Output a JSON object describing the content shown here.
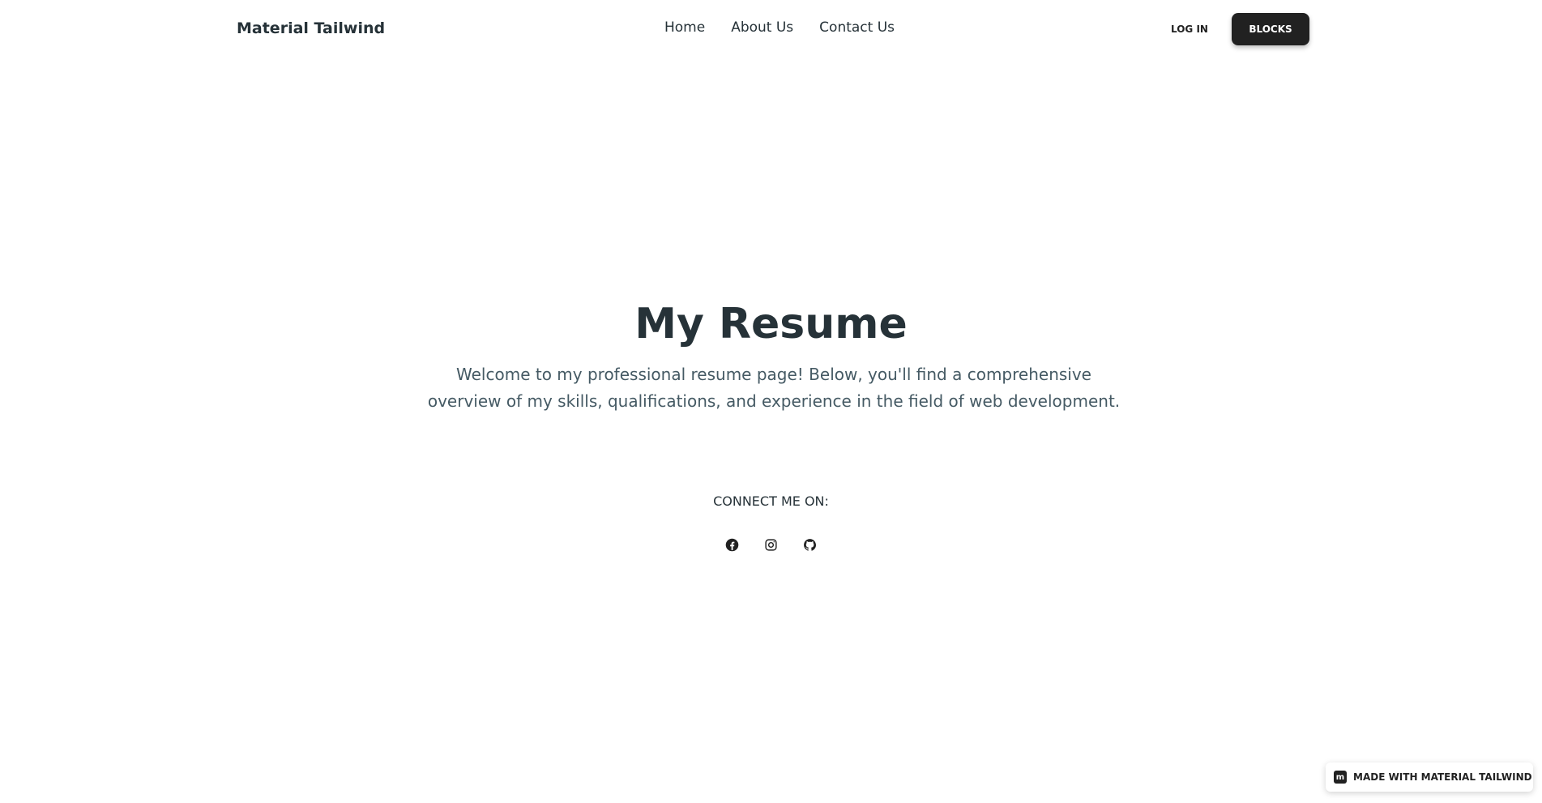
{
  "navbar": {
    "brand": "Material Tailwind",
    "links": [
      "Home",
      "About Us",
      "Contact Us"
    ],
    "login_label": "LOG IN",
    "blocks_label": "BLOCKS"
  },
  "hero": {
    "title": "My Resume",
    "description": "Welcome to my professional resume page! Below, you'll find a comprehensive overview of my skills, qualifications, and experience in the field of web development.",
    "connect_label": "CONNECT ME ON:",
    "social_icons": [
      "facebook-icon",
      "instagram-icon",
      "github-icon"
    ]
  },
  "badge": {
    "logo_letter": "m",
    "label": "MADE WITH MATERIAL TAILWIND"
  },
  "colors": {
    "text_primary": "#263238",
    "text_secondary": "#455a64",
    "button_dark": "#212121"
  }
}
